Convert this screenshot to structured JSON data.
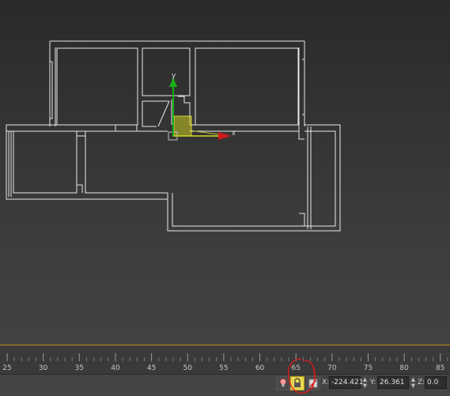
{
  "viewport": {
    "axis_x_label": "x",
    "axis_y_label": "y"
  },
  "timeline": {
    "ticks": [
      "25",
      "30",
      "35",
      "40",
      "45",
      "50",
      "55",
      "60",
      "65",
      "70",
      "75",
      "80",
      "85"
    ]
  },
  "status_bar": {
    "x_label": "X:",
    "x_value": "-224.421",
    "y_label": "Y:",
    "y_value": "26.361",
    "z_label": "Z:",
    "z_value": "0.0"
  },
  "colors": {
    "accent": "#c68a1e",
    "lock_highlight": "#e8d650",
    "annotation": "#e01a1a",
    "gizmo_x": "#d01818",
    "gizmo_y": "#18b018",
    "selection": "#c8c820"
  },
  "icons": [
    "light-bulb-icon",
    "lock-icon",
    "selection-filter-icon",
    "spinner-icon"
  ]
}
